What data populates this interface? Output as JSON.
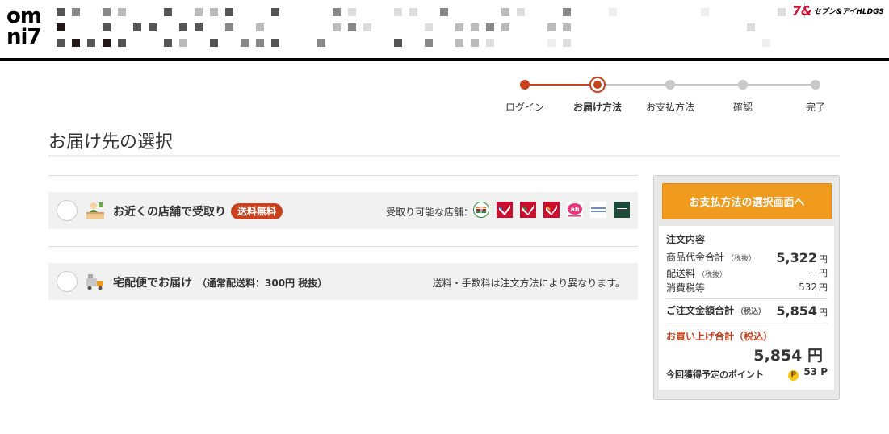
{
  "header": {
    "logo_line1": "om",
    "logo_line2": "ni7",
    "brand_mark": "7&",
    "brand_name": "セブン&アイHLDGS"
  },
  "steps": [
    {
      "label": "ログイン",
      "state": "done"
    },
    {
      "label": "お届け方法",
      "state": "current"
    },
    {
      "label": "お支払方法",
      "state": "todo"
    },
    {
      "label": "確認",
      "state": "todo"
    },
    {
      "label": "完了",
      "state": "todo"
    }
  ],
  "page_title": "お届け先の選択",
  "options": {
    "store": {
      "label": "お近くの店舗で受取り",
      "badge": "送料無料",
      "stores_label": "受取り可能な店舗：",
      "store_icons": [
        "seven-eleven-icon",
        "ito-yokado-icon",
        "york-mart-icon",
        "york-benimaru-icon",
        "akachan-honpo-icon",
        "sogo-seibu-icon",
        "loft-icon"
      ]
    },
    "delivery": {
      "label": "宅配便でお届け",
      "sub": "（通常配送料：300円 税抜）",
      "note": "送料・手数料は注文方法により異なります。"
    }
  },
  "summary": {
    "cta_label": "お支払方法の選択画面へ",
    "heading": "注文内容",
    "rows": {
      "subtotal": {
        "label": "商品代金合計",
        "note": "（税抜）",
        "value": "5,322",
        "unit": "円"
      },
      "shipping": {
        "label": "配送料",
        "note": "（税抜）",
        "value": "--",
        "unit": "円"
      },
      "tax": {
        "label": "消費税等",
        "value": "532",
        "unit": "円"
      },
      "order_total": {
        "label": "ご注文金額合計",
        "note": "（税込）",
        "value": "5,854",
        "unit": "円"
      }
    },
    "purchase_label": "お買い上げ合計（税込）",
    "purchase_value": "5,854 円",
    "points_label": "今回獲得予定のポイント",
    "points_icon": "P",
    "points_value": "53 P"
  },
  "colors": {
    "accent": "#c8421e",
    "cta": "#f09a1e",
    "step_todo": "#c8c8c8"
  }
}
